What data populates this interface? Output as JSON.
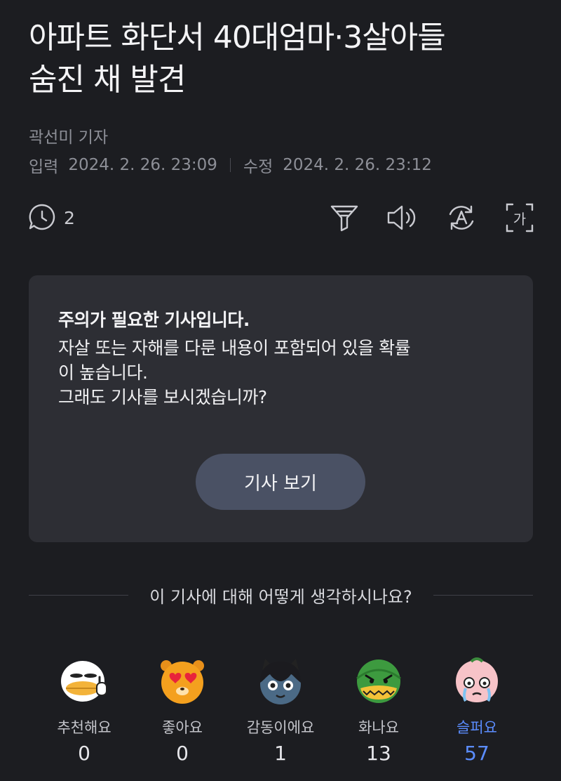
{
  "article": {
    "title_line1": "아파트 화단서 40대엄마·3살아들",
    "title_line2": "숨진 채 발견",
    "reporter": "곽선미 기자",
    "published_label": "입력",
    "published": "2024. 2. 26. 23:09",
    "modified_label": "수정",
    "modified": "2024. 2. 26. 23:12"
  },
  "toolbar": {
    "comment_count": "2",
    "icons": [
      "comment-icon",
      "summary-icon",
      "speaker-icon",
      "translate-icon",
      "font-size-icon"
    ],
    "font_size_glyph": "가"
  },
  "warning": {
    "title": "주의가 필요한 기사입니다.",
    "line1": "자살 또는 자해를 다룬 내용이 포함되어 있을 확률",
    "line2": "이 높습니다.",
    "line3": "그래도 기사를 보시겠습니까?",
    "button": "기사 보기"
  },
  "reactions": {
    "question": "이 기사에 대해 어떻게 생각하시나요?",
    "items": [
      {
        "label": "추천해요",
        "count": "0"
      },
      {
        "label": "좋아요",
        "count": "0"
      },
      {
        "label": "감동이에요",
        "count": "1"
      },
      {
        "label": "화나요",
        "count": "13"
      },
      {
        "label": "슬퍼요",
        "count": "57"
      }
    ],
    "active_color": "#5b8dff"
  }
}
